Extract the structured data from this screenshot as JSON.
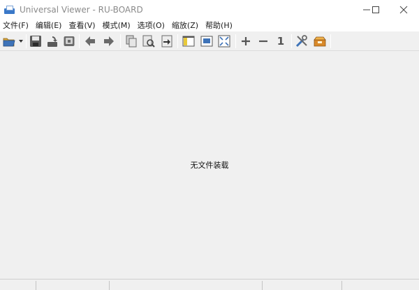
{
  "window": {
    "title": "Universal Viewer - RU-BOARD"
  },
  "menu": [
    "文件(F)",
    "编辑(E)",
    "查看(V)",
    "模式(M)",
    "选项(O)",
    "缩放(Z)",
    "帮助(H)"
  ],
  "toolbar": {
    "icons": [
      "open-folder-icon",
      "dropdown-arrow-icon",
      "save-icon",
      "reload-icon",
      "delete-icon",
      "back-arrow-icon",
      "forward-arrow-icon",
      "copy-icon",
      "find-icon",
      "export-icon",
      "panel-view-icon",
      "fit-window-icon",
      "fullscreen-icon",
      "zoom-in-icon",
      "zoom-out-icon",
      "actual-size-icon",
      "settings-tools-icon",
      "plugins-box-icon"
    ],
    "actual_size_label": "1"
  },
  "content": {
    "empty_message": "无文件装载"
  },
  "status": {
    "sections": [
      "",
      "",
      "",
      "",
      ""
    ]
  },
  "colors": {
    "background": "#f0f0f0",
    "accent": "#3a78c8",
    "toolbar_icon": "#555555"
  }
}
